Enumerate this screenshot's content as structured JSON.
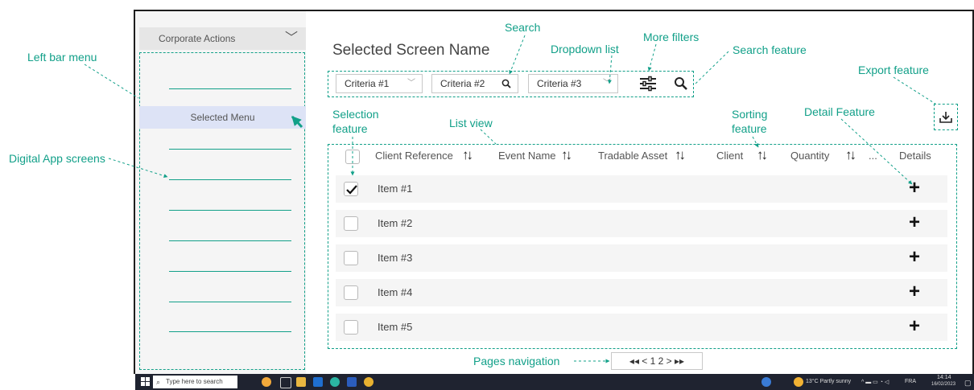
{
  "annotations": {
    "left_bar_menu": "Left bar menu",
    "digital_app_screens": "Digital App screens",
    "search": "Search",
    "dropdown_list": "Dropdown list",
    "more_filters": "More filters",
    "search_feature": "Search feature",
    "export_feature": "Export feature",
    "selection_feature_1": "Selection",
    "selection_feature_2": "feature",
    "list_view": "List view",
    "sorting_feature_1": "Sorting",
    "sorting_feature_2": "feature",
    "detail_feature": "Detail Feature",
    "pages_navigation": "Pages navigation"
  },
  "sidebar": {
    "header": "Corporate Actions",
    "selected_item": "Selected Menu"
  },
  "main": {
    "title": "Selected Screen Name",
    "filters": {
      "criteria1": "Criteria #1",
      "criteria2": "Criteria #2",
      "criteria3": "Criteria #3"
    },
    "columns": {
      "client_reference": "Client Reference",
      "event_name": "Event Name",
      "tradable_asset": "Tradable Asset",
      "client": "Client",
      "quantity": "Quantity",
      "ellipsis": "...",
      "details": "Details"
    },
    "rows": [
      {
        "label": "Item #1",
        "checked": true
      },
      {
        "label": "Item #2",
        "checked": false
      },
      {
        "label": "Item #3",
        "checked": false
      },
      {
        "label": "Item #4",
        "checked": false
      },
      {
        "label": "Item #5",
        "checked": false
      }
    ],
    "pagination": "◂◂ < 1 2 > ▸▸"
  },
  "taskbar": {
    "search_placeholder": "Type here to search",
    "weather": "13°C  Partly sunny",
    "lang": "FRA",
    "time": "14:14",
    "date": "16/02/2023"
  },
  "colors": {
    "annotation": "#12a089",
    "selected_menu_bg": "#dde3f6",
    "taskbar": "#1f2330"
  }
}
